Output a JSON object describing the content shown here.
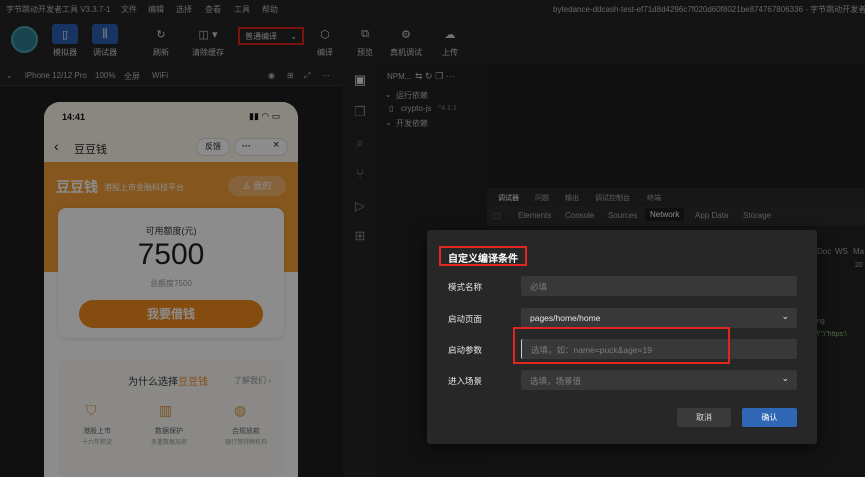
{
  "window": {
    "title": "字节跳动开发者工具 V3.3.7-1",
    "menus": [
      "文件",
      "编辑",
      "选择",
      "查看",
      "工具",
      "帮助"
    ],
    "project": "bytedance-ddcash-test-ef71d8d4296c7f020d60f8021be874767806336 - 字节跳动开发者工具"
  },
  "toolbar": {
    "simulator_label": "模拟器",
    "debugger_label": "调试器",
    "refresh_label": "刷新",
    "clear_cache_label": "清除缓存",
    "compile_mode": "普通编译",
    "compile_label": "编译",
    "preview_label": "预览",
    "device_debug_label": "真机调试",
    "upload_label": "上传"
  },
  "simbar": {
    "device": "iPhone 12/12 Pro",
    "zoom": "100%",
    "screen": "全屏",
    "network": "WiFi"
  },
  "phone": {
    "time": "14:41",
    "title": "豆豆钱",
    "feedback": "反馈",
    "more": "···",
    "close": "×",
    "brand": "豆豆钱",
    "slogan": "港股上市金融科技平台",
    "mine": "我的",
    "credit_label": "可用额度(元)",
    "credit_value": "7500",
    "total_label": "总额度7500",
    "borrow_button": "我要借钱",
    "why_prefix": "为什么选择",
    "why_brand": "豆豆钱",
    "learn_more": "了解我们 ›",
    "features": [
      {
        "title": "港股上市",
        "desc": "十六年积淀"
      },
      {
        "title": "数据保护",
        "desc": "多重数据加密"
      },
      {
        "title": "合规放款",
        "desc": "银行等持牌机构"
      }
    ]
  },
  "explorer": {
    "header": "NPM...",
    "runtime_deps": "运行依赖",
    "package_name": "crypto-js",
    "package_version": "^4.1.1",
    "dev_deps": "开发依赖"
  },
  "devtools": {
    "top_tabs": [
      "调试器",
      "问题",
      "输出",
      "调试控制台",
      "终端"
    ],
    "tabs": [
      "Elements",
      "Console",
      "Sources",
      "Network",
      "App Data",
      "Storage"
    ],
    "active_tab": "Network",
    "col_doc": "Doc",
    "col_ws": "WS",
    "col_ma": "Ma",
    "frag_num": "20",
    "frag_ng": "ng",
    "frag_https": "\\\":\\\"https:\\"
  },
  "dialog": {
    "title": "自定义编译条件",
    "mode_name_label": "模式名称",
    "mode_name_placeholder": "必填",
    "start_page_label": "启动页面",
    "start_page_value": "pages/home/home",
    "start_params_label": "启动参数",
    "start_params_placeholder": "选填，如：name=puck&age=19",
    "scene_label": "进入场景",
    "scene_placeholder": "选填，场景值",
    "cancel_label": "取消",
    "confirm_label": "确认"
  }
}
